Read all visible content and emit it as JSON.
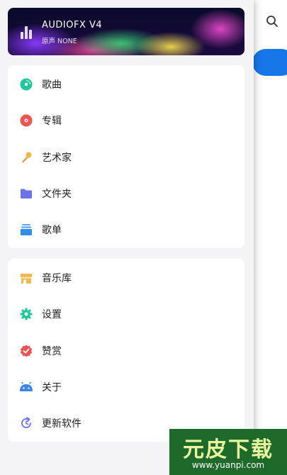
{
  "banner": {
    "title": "AUDIOFX V4",
    "subtitle": "原声 NONE"
  },
  "menu_group_1": [
    {
      "label": "歌曲",
      "icon": "disc-icon",
      "color": "#1fc79a"
    },
    {
      "label": "专辑",
      "icon": "record-icon",
      "color": "#ef5350"
    },
    {
      "label": "艺术家",
      "icon": "microphone-icon",
      "color": "#f2b84b"
    },
    {
      "label": "文件夹",
      "icon": "folder-icon",
      "color": "#6a73e8"
    },
    {
      "label": "歌单",
      "icon": "playlist-icon",
      "color": "#2f8fe8"
    }
  ],
  "menu_group_2": [
    {
      "label": "音乐库",
      "icon": "store-icon",
      "color": "#f2b84b"
    },
    {
      "label": "设置",
      "icon": "gear-icon",
      "color": "#1fc79a"
    },
    {
      "label": "赞赏",
      "icon": "badge-check-icon",
      "color": "#ef5350"
    },
    {
      "label": "关于",
      "icon": "android-icon",
      "color": "#3a86e8"
    },
    {
      "label": "更新软件",
      "icon": "refresh-icon",
      "color": "#6a73e8"
    }
  ],
  "background": {
    "accent": "#1677e8",
    "search_icon": "search-icon"
  },
  "watermark": {
    "logo_text": "元皮下载",
    "url": "www.yuanpi.com"
  }
}
